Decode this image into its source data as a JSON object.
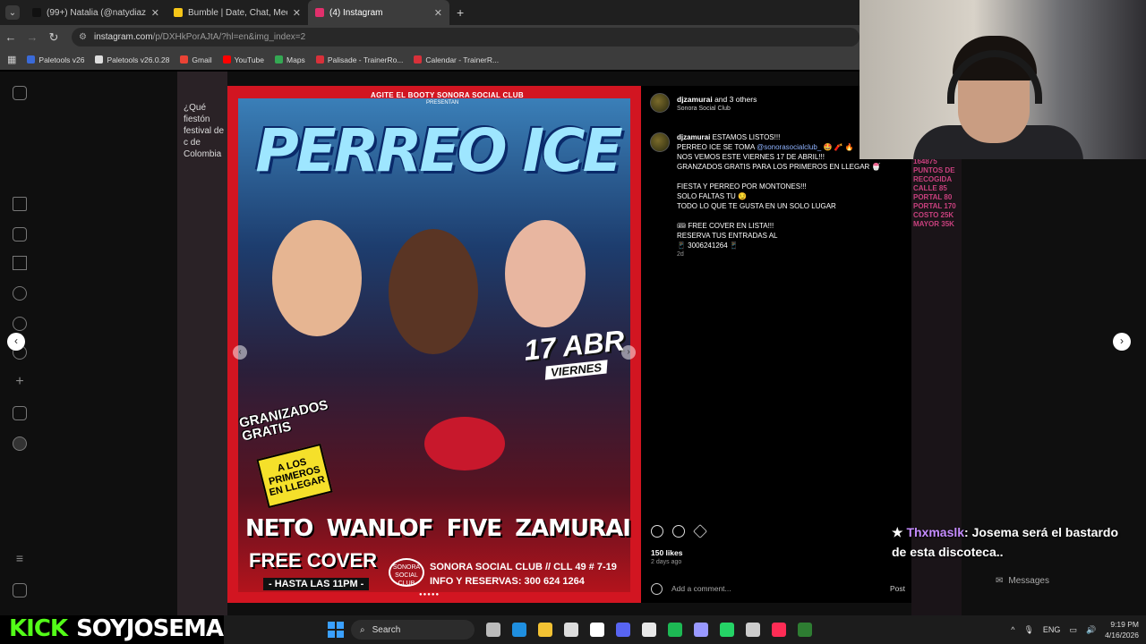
{
  "tabs": [
    {
      "title": "(99+) Natalia (@natydiazz_) |",
      "color": "#111111",
      "active": false
    },
    {
      "title": "Bumble | Date, Chat, Meet New",
      "color": "#f5c518",
      "active": false
    },
    {
      "title": "(4) Instagram",
      "color": "#e1306c",
      "active": true
    }
  ],
  "address": {
    "host": "instagram.com",
    "path": "/p/DXHkPorAJtA/?hl=en&img_index=2"
  },
  "bookmarks": [
    {
      "label": "Paletools v26",
      "color": "#3a6ad8"
    },
    {
      "label": "Paletools v26.0.28",
      "color": "#dddddd"
    },
    {
      "label": "Gmail",
      "color": "#ea4335"
    },
    {
      "label": "YouTube",
      "color": "#ff0000"
    },
    {
      "label": "Maps",
      "color": "#34a853"
    },
    {
      "label": "Palisade - TrainerRo...",
      "color": "#d8313a"
    },
    {
      "label": "Calendar - TrainerR...",
      "color": "#d8313a"
    }
  ],
  "background": {
    "left_text": "¿Qué fiestón festival de c de Colombia",
    "right_text": "164875 PUNTOS DE RECOGIDA CALLE 85 PORTAL 80 PORTAL 170 COSTO 25K MAYOR 35K"
  },
  "poster": {
    "top_line": "AGITE EL BOOTY   SONORA SOCIAL CLUB",
    "presents": "PRESENTAN",
    "title": "PERREO ICE",
    "date": "17 ABR",
    "weekday": "VIERNES",
    "granizados": "GRANIZADOS GRATIS",
    "primeros": "A LOS PRIMEROS EN LLEGAR",
    "djs": [
      "NETO",
      "WANLOF",
      "FIVE",
      "ZAMURAI"
    ],
    "free_cover": "FREE COVER",
    "hasta": "- HASTA LAS 11PM -",
    "sonora_logo": "SONORA SOCIAL CLUB",
    "venue": "SONORA SOCIAL CLUB // CLL 49 # 7-19",
    "reservas": "INFO Y RESERVAS: 300 624 1264"
  },
  "post": {
    "header_user": "djzamurai",
    "header_rest": "and 3 others",
    "header_sub": "Sonora Social Club",
    "caption_user": "djzamurai",
    "caption_line1": "ESTAMOS LISTOS!!!",
    "caption_line2": "PERREO ICE SE TOMA",
    "caption_mention": "@sonorasocialclub_",
    "caption_rest": "🤩 🧨 🔥\nNOS VEMOS ESTE VIERNES 17 DE ABRIL!!!\nGRANZADOS GRATIS PARA LOS PRIMEROS EN LLEGAR 🍧\n\nFIESTA Y PERREO POR MONTONES!!!\nSOLO FALTAS TU 😏\nTODO LO QUE TE GUSTA EN UN SOLO LUGAR\n\n🎟 FREE COVER EN LISTA!!!\nRESERVA TUS ENTRADAS AL\n📱 3006241264 📱",
    "caption_age": "2d",
    "likes": "150 likes",
    "ago": "2 days ago",
    "comment_placeholder": "Add a comment...",
    "post_label": "Post"
  },
  "chat": {
    "user": "Thxmaslk",
    "message": ": Josema será el bastardo de esta discoteca.."
  },
  "messages_label": "Messages",
  "kick": {
    "brand": "KICK",
    "channel": "SOYJOSEMA"
  },
  "taskbar": {
    "search": "Search",
    "lang": "ENG",
    "time": "9:19 PM",
    "date": "4/16/2026",
    "icons": [
      {
        "name": "task-view",
        "color": "#bbbbbb"
      },
      {
        "name": "edge",
        "color": "#1f8fe0"
      },
      {
        "name": "file-explorer",
        "color": "#f3c233"
      },
      {
        "name": "store",
        "color": "#dddddd"
      },
      {
        "name": "tiktok",
        "color": "#ffffff"
      },
      {
        "name": "discord",
        "color": "#5865f2"
      },
      {
        "name": "chrome",
        "color": "#e8e8e8"
      },
      {
        "name": "spotify",
        "color": "#1db954"
      },
      {
        "name": "premiere",
        "color": "#9999ff"
      },
      {
        "name": "whatsapp",
        "color": "#25d366"
      },
      {
        "name": "obs",
        "color": "#cccccc"
      },
      {
        "name": "tiktok-live",
        "color": "#fe2c55"
      },
      {
        "name": "app-green",
        "color": "#2e7d32"
      }
    ]
  }
}
